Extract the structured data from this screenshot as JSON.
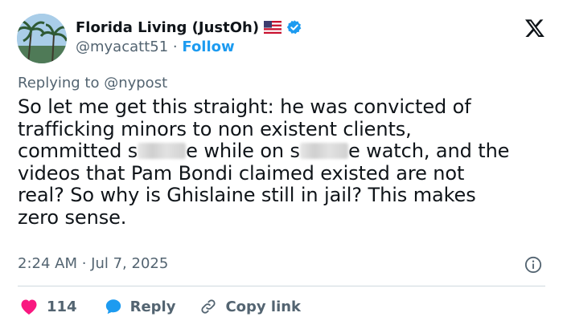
{
  "author": {
    "display_name": "Florida Living (JustOh)",
    "flag_icon": "us-flag-icon",
    "verified_icon": "verified-badge-icon",
    "handle": "@myacatt51",
    "separator": "·",
    "follow_label": "Follow"
  },
  "platform_icon": "x-logo-icon",
  "replying_to": "Replying to @nypost",
  "tweet": {
    "line1": "So let me get this straight: he was convicted of",
    "line2": "trafficking minors to non existent clients,",
    "line3_a": "committed s",
    "line3_b": "e while on s",
    "line3_c": "e watch, and the",
    "line4": "videos that Pam Bondi claimed existed are not",
    "line5": "real? So why is Ghislaine still in jail? This makes",
    "line6": "zero sense."
  },
  "timestamp": "2:24 AM · Jul 7, 2025",
  "actions": {
    "like_count": "114",
    "reply_label": "Reply",
    "copy_label": "Copy link"
  },
  "colors": {
    "accent": "#1d9bf0",
    "like": "#f91880",
    "muted": "#536471",
    "text": "#0f1419"
  }
}
